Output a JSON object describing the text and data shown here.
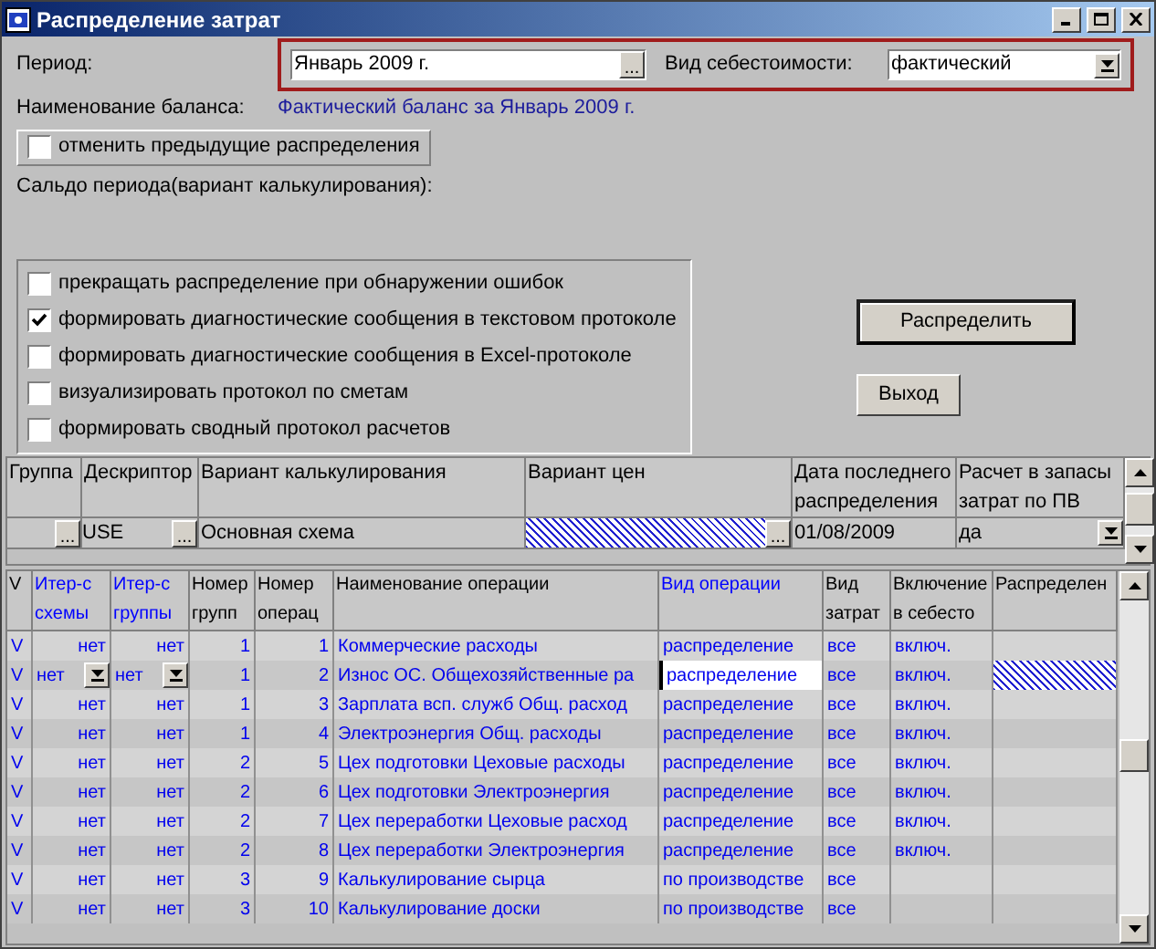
{
  "window": {
    "title": "Распределение затрат"
  },
  "form": {
    "period_label": "Период:",
    "period_value": "Январь 2009 г.",
    "period_button": "...",
    "cost_kind_label": "Вид себестоимости:",
    "cost_kind_value": "фактический",
    "balance_label": "Наименование баланса:",
    "balance_value": "Фактический баланс за Январь 2009 г.",
    "cancel_previous": {
      "label": "отменить предыдущие распределения",
      "checked": false
    },
    "saldo_label": "Сальдо периода(вариант калькулирования):"
  },
  "options": [
    {
      "label": "прекращать распределение при обнаружении ошибок",
      "checked": false
    },
    {
      "label": "формировать диагностические сообщения в текстовом протоколе",
      "checked": true
    },
    {
      "label": "формировать диагностические сообщения в Excel-протоколе",
      "checked": false
    },
    {
      "label": "визуализировать протокол по сметам",
      "checked": false
    },
    {
      "label": "формировать сводный протокол расчетов",
      "checked": false
    }
  ],
  "buttons": [
    "Распределить",
    "Выход"
  ],
  "top_grid": {
    "columns": [
      "Группа",
      "Дескриптор",
      "Вариант калькулирования",
      "Вариант цен",
      "Дата последнего распределения",
      "Расчет в запасы затрат по ПВ"
    ],
    "row": {
      "group_button": "...",
      "descriptor": "USE",
      "descriptor_button": "...",
      "calc_variant": "Основная схема",
      "price_button": "...",
      "date": "01/08/2009",
      "calc_in_stock": "да"
    }
  },
  "ops_grid": {
    "columns": [
      "V",
      "Итер-с схемы",
      "Итер-с группы",
      "Номер групп",
      "Номер операц",
      "Наименование операции",
      "Вид операции",
      "Вид затрат",
      "Включение в себесто",
      "Распределен"
    ],
    "rows": [
      {
        "cells": [
          "V",
          "нет",
          "нет",
          "1",
          "1",
          "Коммерческие расходы",
          "распределение",
          "все",
          "включ."
        ],
        "selected": false
      },
      {
        "cells": [
          "V",
          "нет",
          "нет",
          "1",
          "2",
          "Износ ОС. Общехозяйственные ра",
          "распределение",
          "все",
          "включ."
        ],
        "selected": true
      },
      {
        "cells": [
          "V",
          "нет",
          "нет",
          "1",
          "3",
          "Зарплата всп. служб Общ. расход",
          "распределение",
          "все",
          "включ."
        ],
        "selected": false
      },
      {
        "cells": [
          "V",
          "нет",
          "нет",
          "1",
          "4",
          "Электроэнергия Общ. расходы",
          "распределение",
          "все",
          "включ."
        ],
        "selected": false
      },
      {
        "cells": [
          "V",
          "нет",
          "нет",
          "2",
          "5",
          "Цех подготовки Цеховые расходы",
          "распределение",
          "все",
          "включ."
        ],
        "selected": false
      },
      {
        "cells": [
          "V",
          "нет",
          "нет",
          "2",
          "6",
          "Цех подготовки Электроэнергия",
          "распределение",
          "все",
          "включ."
        ],
        "selected": false
      },
      {
        "cells": [
          "V",
          "нет",
          "нет",
          "2",
          "7",
          "Цех переработки Цеховые расход",
          "распределение",
          "все",
          "включ."
        ],
        "selected": false
      },
      {
        "cells": [
          "V",
          "нет",
          "нет",
          "2",
          "8",
          "Цех переработки Электроэнергия",
          "распределение",
          "все",
          "включ."
        ],
        "selected": false
      },
      {
        "cells": [
          "V",
          "нет",
          "нет",
          "3",
          "9",
          "Калькулирование сырца",
          "по производстве",
          "все",
          ""
        ],
        "selected": false
      },
      {
        "cells": [
          "V",
          "нет",
          "нет",
          "3",
          "10",
          "Калькулирование доски",
          "по производстве",
          "все",
          ""
        ],
        "selected": false
      }
    ]
  }
}
